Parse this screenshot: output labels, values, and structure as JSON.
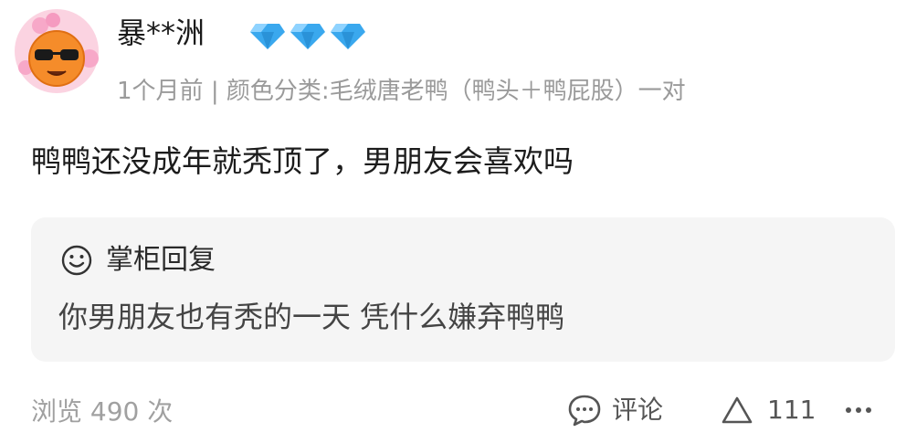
{
  "user": {
    "name": "暴**洲",
    "avatar_icon": "sunglasses-orange-avatar",
    "badge_count": 3,
    "badge_color": "#3aa8ee"
  },
  "meta": {
    "time": "1个月前",
    "separator": "|",
    "variant": "颜色分类:毛绒唐老鸭（鸭头＋鸭屁股）一对"
  },
  "review": {
    "text": "鸭鸭还没成年就秃顶了，男朋友会喜欢吗"
  },
  "reply": {
    "icon": "smile-face-icon",
    "title": "掌柜回复",
    "text": "你男朋友也有秃的一天 凭什么嫌弃鸭鸭"
  },
  "footer": {
    "views": "浏览 490 次",
    "comment_label": "评论",
    "like_count": "111"
  }
}
